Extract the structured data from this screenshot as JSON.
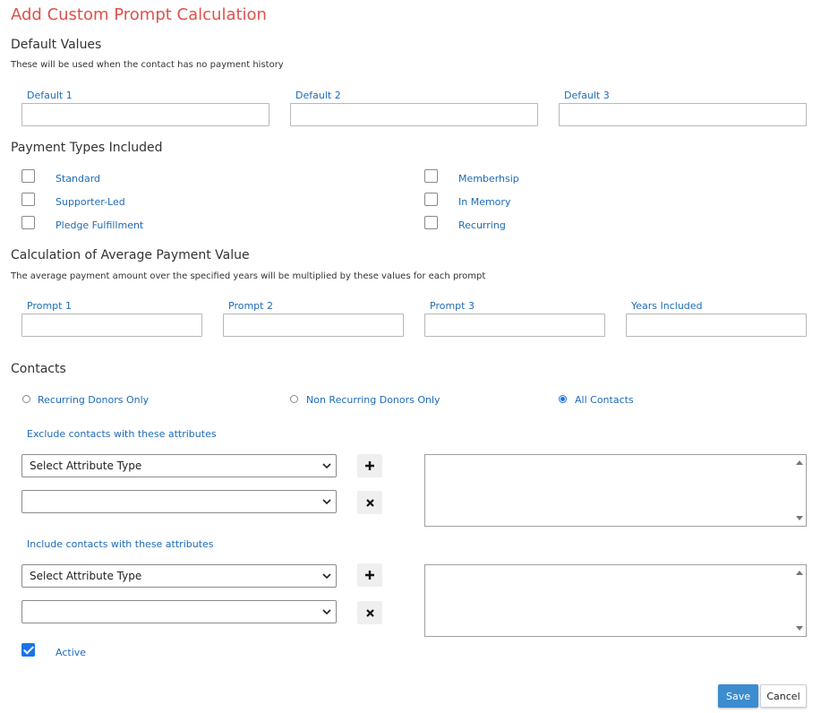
{
  "title": "Add Custom Prompt Calculation",
  "default_values": {
    "heading": "Default Values",
    "description": "These will be used when the contact has no payment history",
    "fields": [
      {
        "label": "Default 1",
        "value": ""
      },
      {
        "label": "Default 2",
        "value": ""
      },
      {
        "label": "Default 3",
        "value": ""
      }
    ]
  },
  "payment_types": {
    "heading": "Payment Types Included",
    "items": [
      {
        "label": "Standard",
        "checked": false
      },
      {
        "label": "Supporter-Led",
        "checked": false
      },
      {
        "label": "Pledge Fulfillment",
        "checked": false
      },
      {
        "label": "Memberhsip",
        "checked": false
      },
      {
        "label": "In Memory",
        "checked": false
      },
      {
        "label": "Recurring",
        "checked": false
      }
    ]
  },
  "calculation": {
    "heading": "Calculation of Average Payment Value",
    "description": "The average payment amount over the specified years will be multiplied by these values for each prompt",
    "fields": [
      {
        "label": "Prompt 1",
        "value": ""
      },
      {
        "label": "Prompt 2",
        "value": ""
      },
      {
        "label": "Prompt 3",
        "value": ""
      },
      {
        "label": "Years Included",
        "value": ""
      }
    ]
  },
  "contacts": {
    "heading": "Contacts",
    "options": [
      {
        "label": "Recurring Donors Only",
        "selected": false
      },
      {
        "label": "Non Recurring Donors Only",
        "selected": false
      },
      {
        "label": "All Contacts",
        "selected": true
      }
    ],
    "exclude": {
      "label": "Exclude contacts with these attributes",
      "type_select": "Select Attribute Type",
      "value_select": ""
    },
    "include": {
      "label": "Include contacts with these attributes",
      "type_select": "Select Attribute Type",
      "value_select": ""
    }
  },
  "active": {
    "label": "Active",
    "checked": true
  },
  "buttons": {
    "save": "Save",
    "cancel": "Cancel"
  },
  "colors": {
    "title": "#e0504a",
    "link": "#1e6bb8",
    "primary": "#3c8cd0",
    "checkbox": "#1a73e8"
  }
}
